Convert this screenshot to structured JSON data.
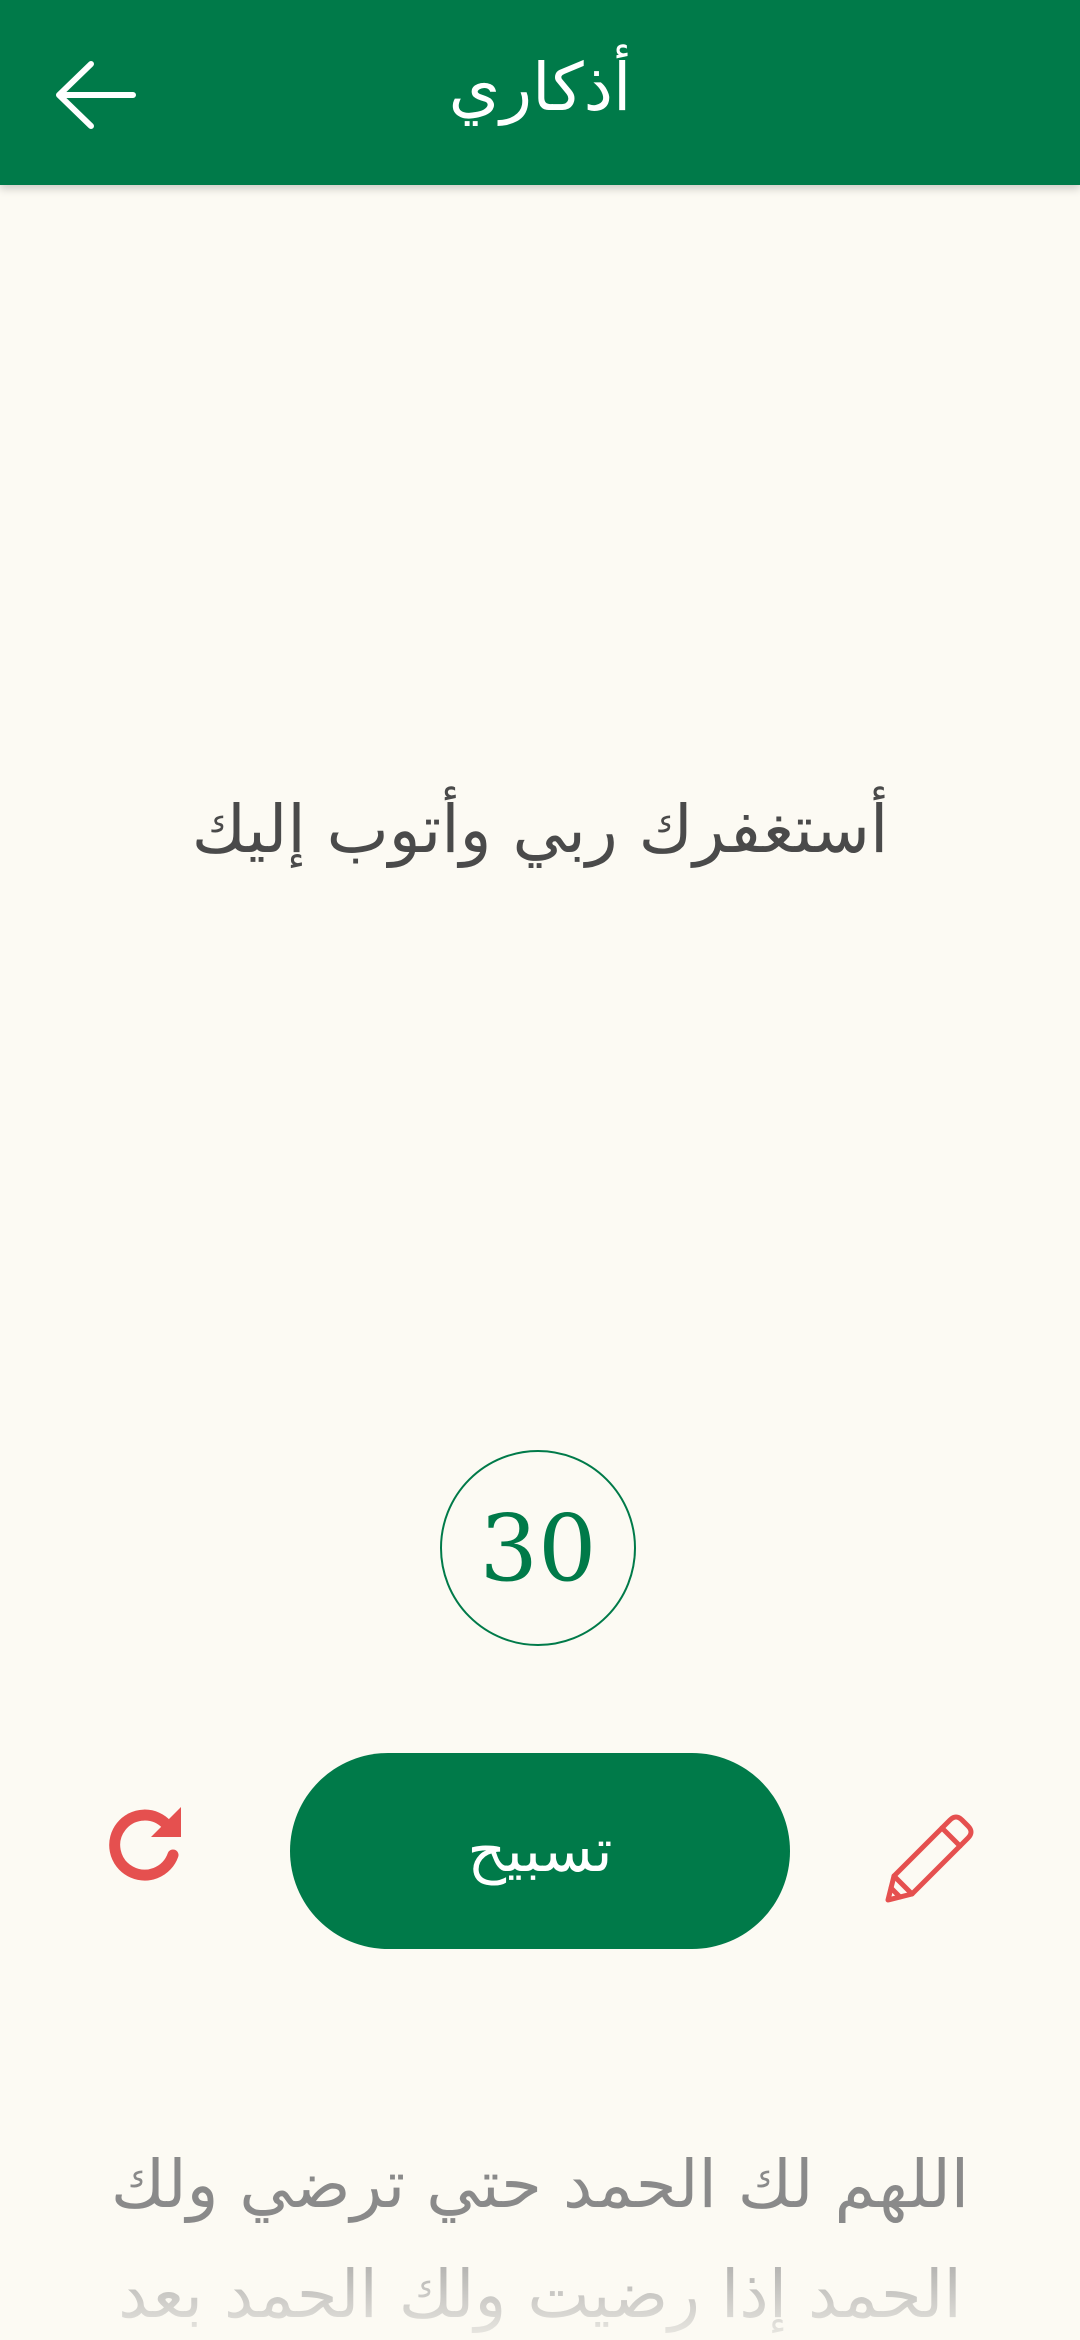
{
  "appbar": {
    "title": "أذكاري",
    "back_icon": "arrow-left-icon",
    "background_color": "#007a49"
  },
  "dhikr": {
    "text": "أستغفرك ربي وأتوب إليك"
  },
  "counter": {
    "value": "30"
  },
  "controls": {
    "tasbih_label": "تسبيح",
    "reset_icon": "refresh-icon",
    "edit_icon": "pencil-icon",
    "accent_color": "#007a49",
    "icon_color": "#e5504f"
  },
  "next_dhikr": {
    "text": "اللهم لك الحمد حتي ترضي ولك الحمد إذا رضيت ولك الحمد بعد"
  }
}
